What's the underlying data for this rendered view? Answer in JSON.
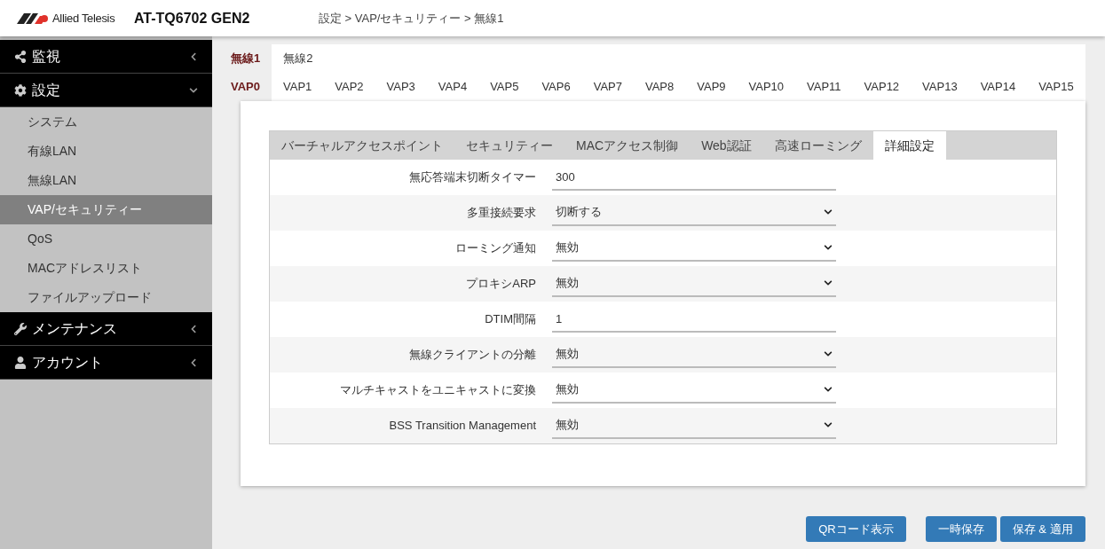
{
  "header": {
    "logo_text": "Allied Telesis",
    "model": "AT-TQ6702 GEN2",
    "breadcrumb": "設定 > VAP/セキュリティー > 無線1"
  },
  "sidebar": {
    "items": [
      {
        "label": "監視",
        "kind": "share",
        "expanded": false
      },
      {
        "label": "設定",
        "kind": "gear",
        "expanded": true,
        "children": [
          {
            "label": "システム",
            "selected": false
          },
          {
            "label": "有線LAN",
            "selected": false
          },
          {
            "label": "無線LAN",
            "selected": false
          },
          {
            "label": "VAP/セキュリティー",
            "selected": true
          },
          {
            "label": "QoS",
            "selected": false
          },
          {
            "label": "MACアドレスリスト",
            "selected": false
          },
          {
            "label": "ファイルアップロード",
            "selected": false
          }
        ]
      },
      {
        "label": "メンテナンス",
        "kind": "wrench",
        "expanded": false
      },
      {
        "label": "アカウント",
        "kind": "user",
        "expanded": false
      }
    ]
  },
  "radio_tabs": [
    {
      "label": "無線1",
      "selected": true
    },
    {
      "label": "無線2",
      "selected": false
    }
  ],
  "vap_tabs": [
    {
      "label": "VAP0",
      "selected": true
    },
    {
      "label": "VAP1",
      "selected": false
    },
    {
      "label": "VAP2",
      "selected": false
    },
    {
      "label": "VAP3",
      "selected": false
    },
    {
      "label": "VAP4",
      "selected": false
    },
    {
      "label": "VAP5",
      "selected": false
    },
    {
      "label": "VAP6",
      "selected": false
    },
    {
      "label": "VAP7",
      "selected": false
    },
    {
      "label": "VAP8",
      "selected": false
    },
    {
      "label": "VAP9",
      "selected": false
    },
    {
      "label": "VAP10",
      "selected": false
    },
    {
      "label": "VAP11",
      "selected": false
    },
    {
      "label": "VAP12",
      "selected": false
    },
    {
      "label": "VAP13",
      "selected": false
    },
    {
      "label": "VAP14",
      "selected": false
    },
    {
      "label": "VAP15",
      "selected": false
    }
  ],
  "section_tabs": [
    {
      "label": "バーチャルアクセスポイント",
      "selected": false
    },
    {
      "label": "セキュリティー",
      "selected": false
    },
    {
      "label": "MACアクセス制御",
      "selected": false
    },
    {
      "label": "Web認証",
      "selected": false
    },
    {
      "label": "高速ローミング",
      "selected": false
    },
    {
      "label": "詳細設定",
      "selected": true
    }
  ],
  "fields": [
    {
      "label": "無応答端末切断タイマー",
      "kind": "text",
      "value": "300"
    },
    {
      "label": "多重接続要求",
      "kind": "select",
      "value": "切断する"
    },
    {
      "label": "ローミング通知",
      "kind": "select",
      "value": "無効"
    },
    {
      "label": "プロキシARP",
      "kind": "select",
      "value": "無効"
    },
    {
      "label": "DTIM間隔",
      "kind": "text",
      "value": "1"
    },
    {
      "label": "無線クライアントの分離",
      "kind": "select",
      "value": "無効"
    },
    {
      "label": "マルチキャストをユニキャストに変換",
      "kind": "select",
      "value": "無効"
    },
    {
      "label": "BSS Transition Management",
      "kind": "select",
      "value": "無効"
    }
  ],
  "buttons": [
    {
      "label": "QRコード表示"
    },
    {
      "label": "一時保存"
    },
    {
      "label": "保存 & 適用"
    }
  ]
}
